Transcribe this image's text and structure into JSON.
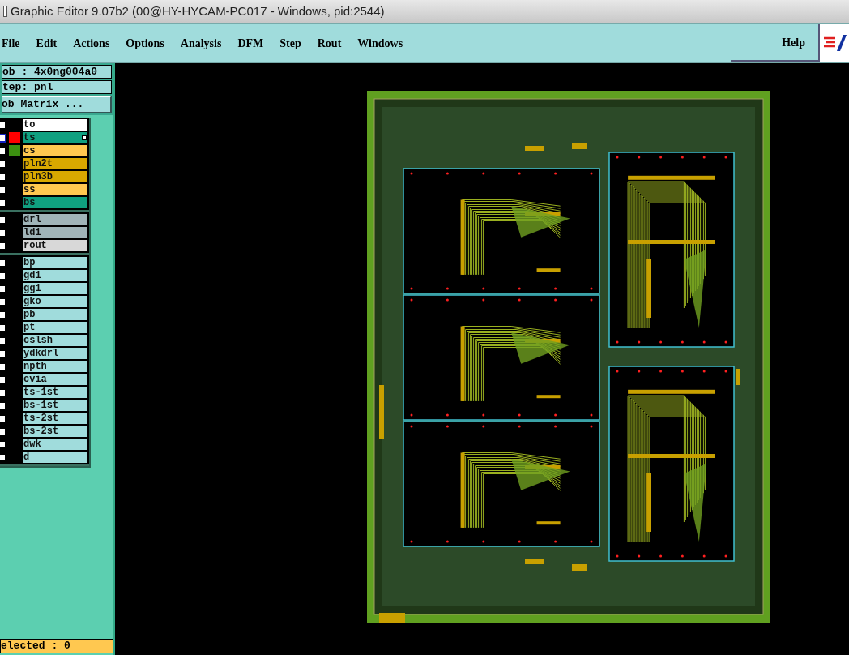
{
  "window": {
    "title": "Graphic Editor 9.07b2 (00@HY-HYCAM-PC017 - Windows, pid:2544)"
  },
  "menu": [
    "File",
    "Edit",
    "Actions",
    "Options",
    "Analysis",
    "DFM",
    "Step",
    "Rout",
    "Windows"
  ],
  "help": "Help",
  "job": "ob : 4x0ng004a0",
  "step": "tep: pnl",
  "job_matrix_button": "ob Matrix ...",
  "layer_groups": [
    {
      "layers": [
        {
          "name": "to",
          "kind": "silk_screen",
          "selected": false,
          "affected": false
        },
        {
          "name": "ts",
          "kind": "solder_mask",
          "selected": true,
          "color": "#ff0000",
          "affected": true
        },
        {
          "name": "cs",
          "kind": "signal",
          "selected": false,
          "color": "#3c9010",
          "affected": false
        },
        {
          "name": "pln2t",
          "kind": "power_ground",
          "selected": false,
          "affected": false
        },
        {
          "name": "pln3b",
          "kind": "power_ground",
          "selected": false,
          "affected": false
        },
        {
          "name": "ss",
          "kind": "signal",
          "selected": false,
          "affected": false
        },
        {
          "name": "bs",
          "kind": "solder_mask",
          "selected": false,
          "affected": false
        }
      ]
    },
    {
      "layers": [
        {
          "name": "drl",
          "kind": "drill",
          "selected": false,
          "affected": false
        },
        {
          "name": "ldi",
          "kind": "drill",
          "selected": false,
          "affected": false
        },
        {
          "name": "rout",
          "kind": "rout",
          "selected": false,
          "affected": false
        }
      ]
    },
    {
      "layers": [
        {
          "name": "bp",
          "kind": "document",
          "selected": false,
          "affected": false
        },
        {
          "name": "gd1",
          "kind": "document",
          "selected": false,
          "affected": false
        },
        {
          "name": "gg1",
          "kind": "document",
          "selected": false,
          "affected": false
        },
        {
          "name": "gko",
          "kind": "document",
          "selected": false,
          "affected": false
        },
        {
          "name": "pb",
          "kind": "document",
          "selected": false,
          "affected": false
        },
        {
          "name": "pt",
          "kind": "document",
          "selected": false,
          "affected": false
        },
        {
          "name": "cslsh",
          "kind": "document",
          "selected": false,
          "affected": false
        },
        {
          "name": "ydkdrl",
          "kind": "document",
          "selected": false,
          "affected": false
        },
        {
          "name": "npth",
          "kind": "document",
          "selected": false,
          "affected": false
        },
        {
          "name": "cvia",
          "kind": "document",
          "selected": false,
          "affected": false
        },
        {
          "name": "ts-1st",
          "kind": "document",
          "selected": false,
          "affected": false
        },
        {
          "name": "bs-1st",
          "kind": "document",
          "selected": false,
          "affected": false
        },
        {
          "name": "ts-2st",
          "kind": "document",
          "selected": false,
          "affected": false
        },
        {
          "name": "bs-2st",
          "kind": "document",
          "selected": false,
          "affected": false
        },
        {
          "name": "dwk",
          "kind": "document",
          "selected": false,
          "affected": false
        },
        {
          "name": "d",
          "kind": "document",
          "selected": false,
          "affected": false
        }
      ]
    }
  ],
  "selected_count": "elected : 0"
}
